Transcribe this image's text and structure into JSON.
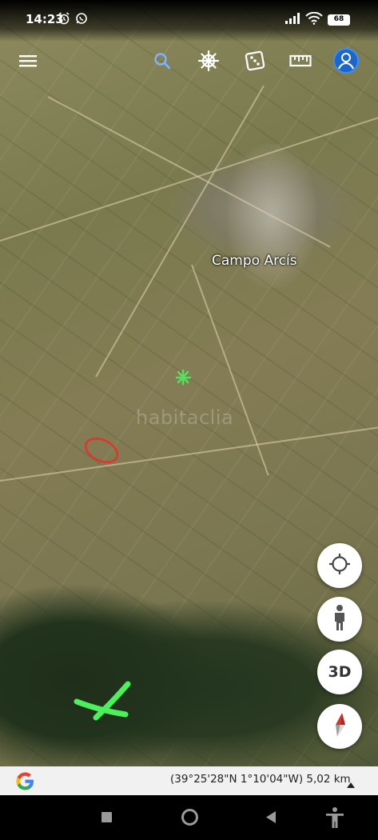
{
  "status_bar": {
    "time": "14:23",
    "alarm_icon": "alarm-clock-icon",
    "whatsapp_icon": "whatsapp-icon",
    "battery_level": "68"
  },
  "toolbar": {
    "menu_icon": "hamburger-menu-icon",
    "search_icon": "search-icon",
    "voyager_icon": "ship-wheel-icon",
    "feeling_lucky_icon": "dice-icon",
    "measure_icon": "ruler-icon",
    "account_icon": "account-circle-icon"
  },
  "map": {
    "place_label": "Campo Arcís",
    "watermark": "habitaclia",
    "annotation_colors": {
      "red_circle": "#e0352b",
      "green_cross": "#4cf05a",
      "green_star": "#57e05f"
    }
  },
  "map_controls": {
    "locate_icon": "my-location-icon",
    "street_view_icon": "pegman-icon",
    "three_d_label": "3D",
    "compass_icon": "compass-icon"
  },
  "info_bar": {
    "logo": "google-g-logo",
    "coordinates": "(39°25'28\"N 1°10'04\"W) 5,02 km",
    "expand_icon": "triangle-up-icon"
  },
  "nav_bar": {
    "recents_icon": "square-recents-icon",
    "home_icon": "circle-home-icon",
    "back_icon": "triangle-back-icon",
    "accessibility_icon": "accessibility-icon"
  }
}
